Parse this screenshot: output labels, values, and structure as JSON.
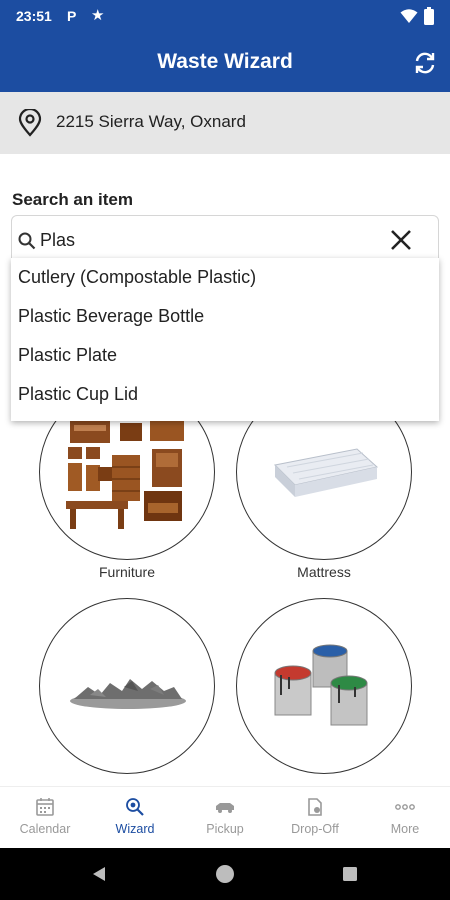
{
  "status_bar": {
    "time": "23:51",
    "notification_p": "P",
    "notification_star": "★"
  },
  "app_bar": {
    "title": "Waste Wizard",
    "brand_color": "#1c4da1"
  },
  "address": {
    "text": "2215 Sierra Way, Oxnard"
  },
  "search": {
    "label": "Search an item",
    "value": "Plas"
  },
  "suggestions": [
    "Cutlery (Compostable Plastic)",
    "Plastic Beverage Bottle",
    "Plastic Plate",
    "Plastic Cup Lid"
  ],
  "categories": [
    {
      "label": "Furniture",
      "icon": "furniture-icon"
    },
    {
      "label": "Mattress",
      "icon": "mattress-icon"
    },
    {
      "label": "",
      "icon": "rubble-icon"
    },
    {
      "label": "",
      "icon": "paint-cans-icon"
    }
  ],
  "bottom_nav": [
    {
      "label": "Calendar",
      "icon": "calendar-icon",
      "active": false
    },
    {
      "label": "Wizard",
      "icon": "wizard-search-icon",
      "active": true
    },
    {
      "label": "Pickup",
      "icon": "truck-icon",
      "active": false
    },
    {
      "label": "Drop-Off",
      "icon": "dropoff-icon",
      "active": false
    },
    {
      "label": "More",
      "icon": "more-icon",
      "active": false
    }
  ]
}
